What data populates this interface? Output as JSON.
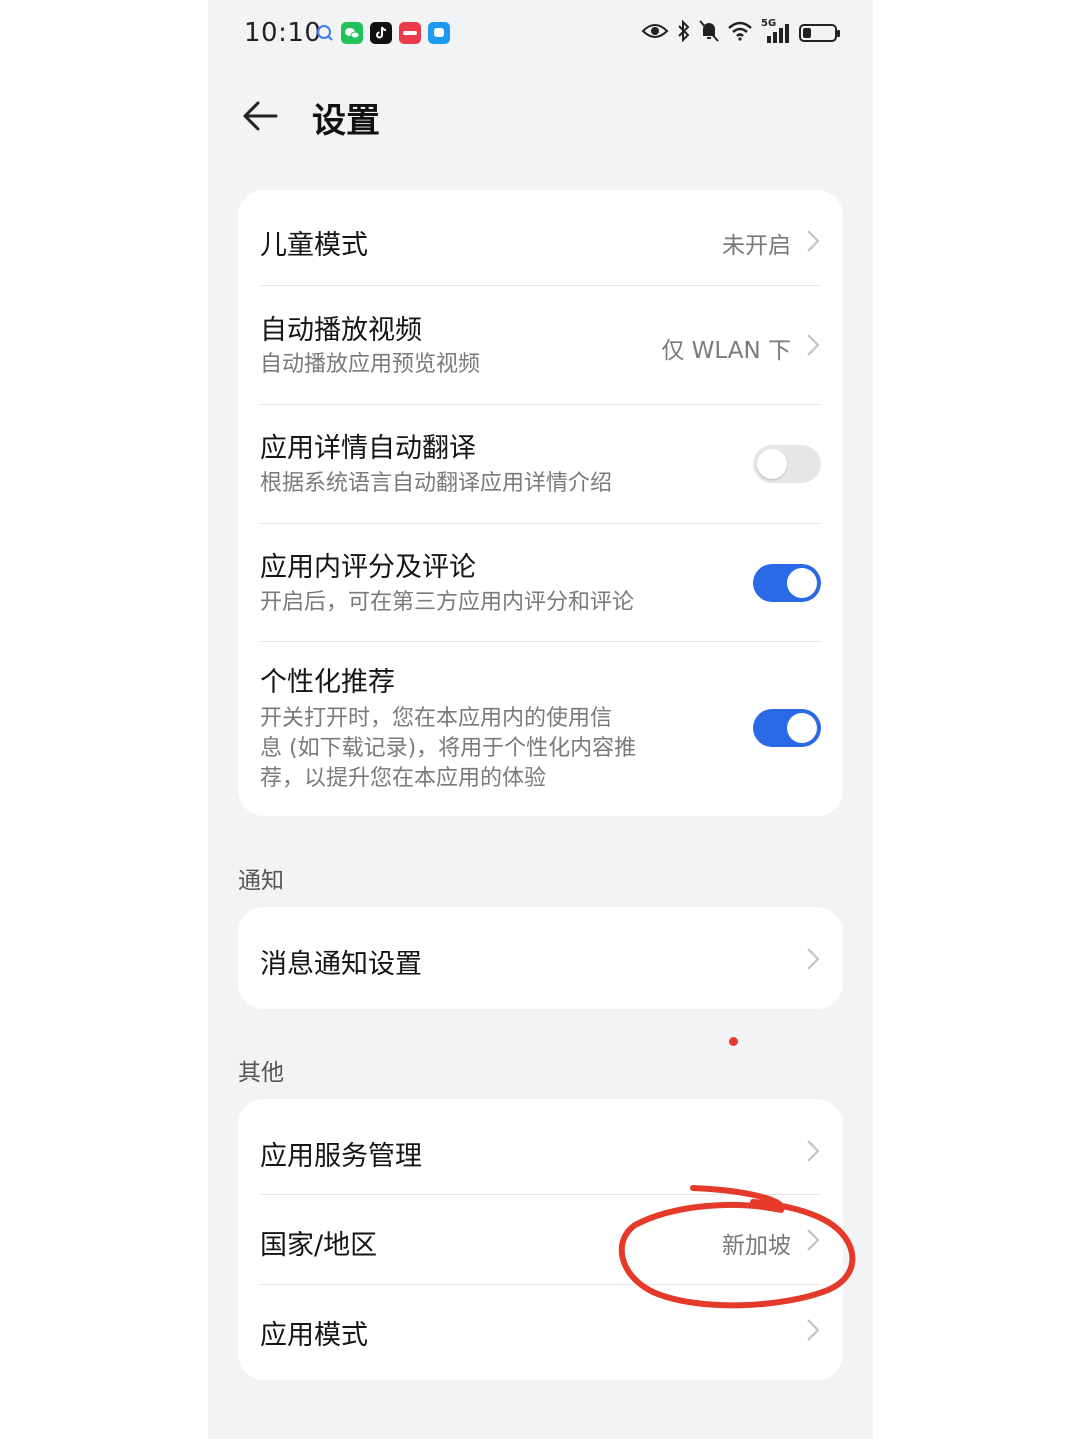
{
  "status_bar": {
    "time": "10:10",
    "network": "5G",
    "battery_level": 0.25
  },
  "header": {
    "back_icon": "arrow-left-icon",
    "title": "设置"
  },
  "general_settings": {
    "kids_mode": {
      "title": "儿童模式",
      "value": "未开启"
    },
    "autoplay_video": {
      "title": "自动播放视频",
      "subtitle": "自动播放应用预览视频",
      "value": "仅 WLAN 下"
    },
    "auto_translate": {
      "title": "应用详情自动翻译",
      "subtitle": "根据系统语言自动翻译应用详情介绍",
      "enabled": false
    },
    "in_app_rating": {
      "title": "应用内评分及评论",
      "subtitle": "开启后，可在第三方应用内评分和评论",
      "enabled": true
    },
    "personalized": {
      "title": "个性化推荐",
      "subtitle_lines": [
        "开关打开时，您在本应用内的使用信",
        "息 (如下载记录)，将用于个性化内容推",
        "荐，以提升您在本应用的体验"
      ],
      "enabled": true
    }
  },
  "notifications": {
    "section_label": "通知",
    "message_settings": {
      "title": "消息通知设置"
    }
  },
  "other": {
    "section_label": "其他",
    "service_management": {
      "title": "应用服务管理"
    },
    "region": {
      "title": "国家/地区",
      "value": "新加坡"
    },
    "app_mode": {
      "title": "应用模式"
    }
  },
  "colors": {
    "accent": "#2a6ae6",
    "annotation": "#e53a2a",
    "background": "#f1f3f5"
  }
}
